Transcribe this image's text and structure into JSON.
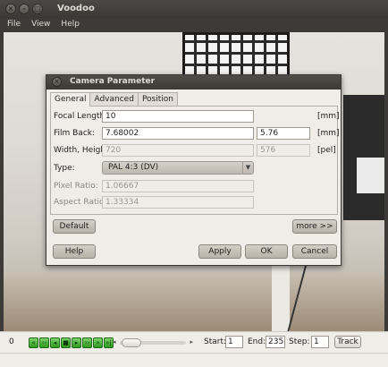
{
  "window": {
    "title": "Voodoo"
  },
  "menu": [
    "File",
    "View",
    "Help"
  ],
  "dialog": {
    "title": "Camera Parameter",
    "tabs": [
      "General",
      "Advanced",
      "Position"
    ],
    "fields": {
      "focal_length": {
        "label": "Focal Length:",
        "value": "10",
        "unit": "[mm]"
      },
      "film_back": {
        "label": "Film Back:",
        "value1": "7.68002",
        "value2": "5.76",
        "unit": "[mm]"
      },
      "width_height": {
        "label": "Width, Height:",
        "value1": "720",
        "value2": "576",
        "unit": "[pel]"
      },
      "type": {
        "label": "Type:",
        "value": "PAL 4:3 (DV)"
      },
      "pixel_ratio": {
        "label": "Pixel Ratio:",
        "value": "1.06667"
      },
      "aspect_ratio": {
        "label": "Aspect Ratio:",
        "value": "1.33334"
      }
    },
    "buttons": {
      "default": "Default",
      "more": "more >>",
      "help": "Help",
      "apply": "Apply",
      "ok": "OK",
      "cancel": "Cancel"
    }
  },
  "toolbar": {
    "frame": "0",
    "start_label": "Start:",
    "start_value": "1",
    "end_label": "End:",
    "end_value": "235",
    "step_label": "Step:",
    "step_value": "1",
    "track_label": "Track"
  }
}
